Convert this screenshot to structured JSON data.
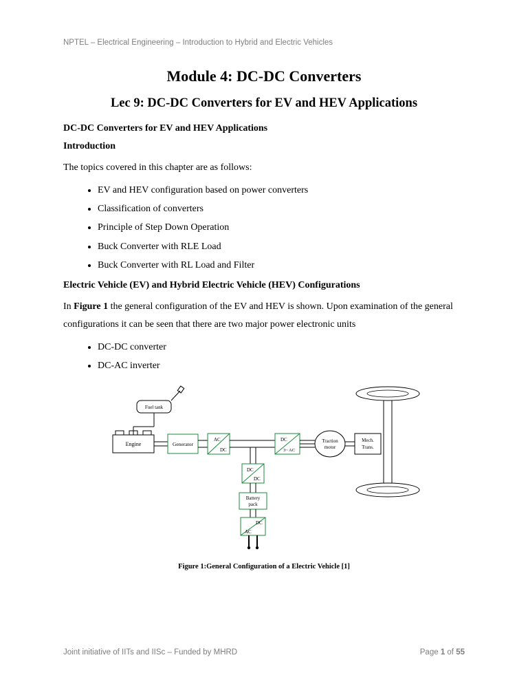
{
  "header": {
    "meta": "NPTEL – Electrical Engineering –  Introduction to Hybrid and Electric Vehicles"
  },
  "titles": {
    "module": "Module 4: DC-DC Converters",
    "lecture": "Lec 9: DC-DC Converters for EV and HEV Applications"
  },
  "section": {
    "heading": "DC-DC Converters for EV and HEV Applications",
    "intro_label": "Introduction",
    "intro_text": "The topics covered in this chapter are as follows:"
  },
  "topics": [
    "EV and HEV configuration based on power converters",
    "Classification of converters",
    "Principle of Step Down Operation",
    "Buck Converter with RLE Load",
    "Buck Converter with RL Load and Filter"
  ],
  "config_heading": "Electric Vehicle (EV) and Hybrid Electric Vehicle (HEV) Configurations",
  "paragraph": {
    "pre": "In ",
    "bold": "Figure 1",
    "post": " the general configuration of the EV and HEV is shown. Upon examination of the general configurations it can be seen that there are two major power electronic units"
  },
  "units": [
    "DC-DC converter",
    "DC-AC inverter"
  ],
  "figure": {
    "caption": "Figure 1:General Configuration of a Electric Vehicle [1]",
    "labels": {
      "fuel_tank": "Fuel tank",
      "engine": "Engine",
      "generator": "Generator",
      "ac_dc_1_top": "AC",
      "ac_dc_1_bot": "DC",
      "dc_ac_top": "DC",
      "dc_ac_bot": "3~ AC",
      "traction": "Traction",
      "traction2": "motor",
      "mech": "Mech.",
      "mech2": "Trans.",
      "dc_dc_top": "DC",
      "dc_dc_bot": "DC",
      "battery": "Battery",
      "battery2": "pack",
      "dc_ac2_top": "DC",
      "dc_ac2_bot": "AC"
    }
  },
  "footer": {
    "left": "Joint initiative of IITs and IISc – Funded by MHRD",
    "page_pre": "Page ",
    "page_num": "1",
    "page_mid": " of ",
    "page_total": "55"
  }
}
